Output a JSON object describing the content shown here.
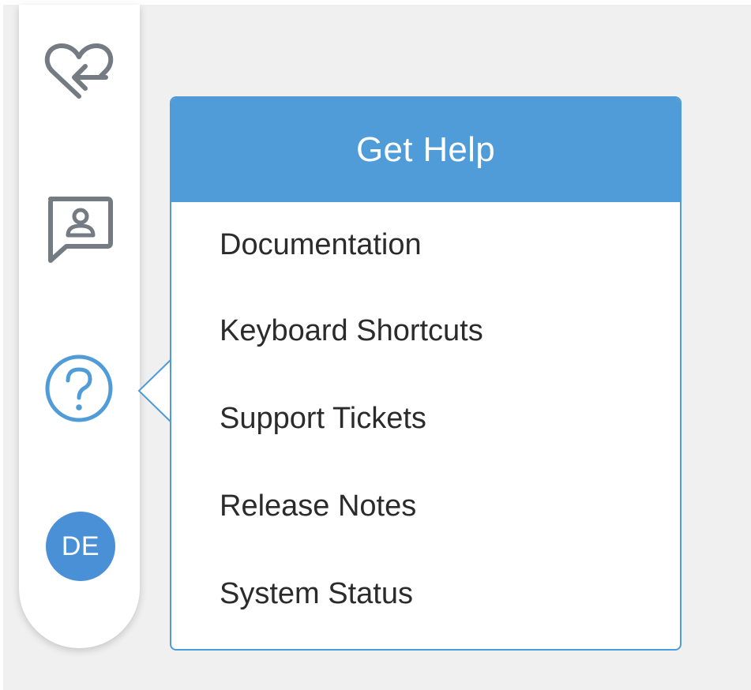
{
  "sidebar": {
    "icons": [
      {
        "name": "favorites",
        "icon": "heart-arrow-icon"
      },
      {
        "name": "contact",
        "icon": "contact-card-icon"
      },
      {
        "name": "help",
        "icon": "question-circle-icon"
      }
    ],
    "avatar_initials": "DE"
  },
  "help_menu": {
    "title": "Get Help",
    "items": [
      {
        "label": "Documentation"
      },
      {
        "label": "Keyboard Shortcuts"
      },
      {
        "label": "Support Tickets"
      },
      {
        "label": "Release Notes"
      },
      {
        "label": "System Status"
      }
    ]
  },
  "colors": {
    "accent": "#4f9cd9",
    "avatar": "#4a90d6",
    "icon_gray": "#757b82",
    "background": "#f0f0f0"
  }
}
